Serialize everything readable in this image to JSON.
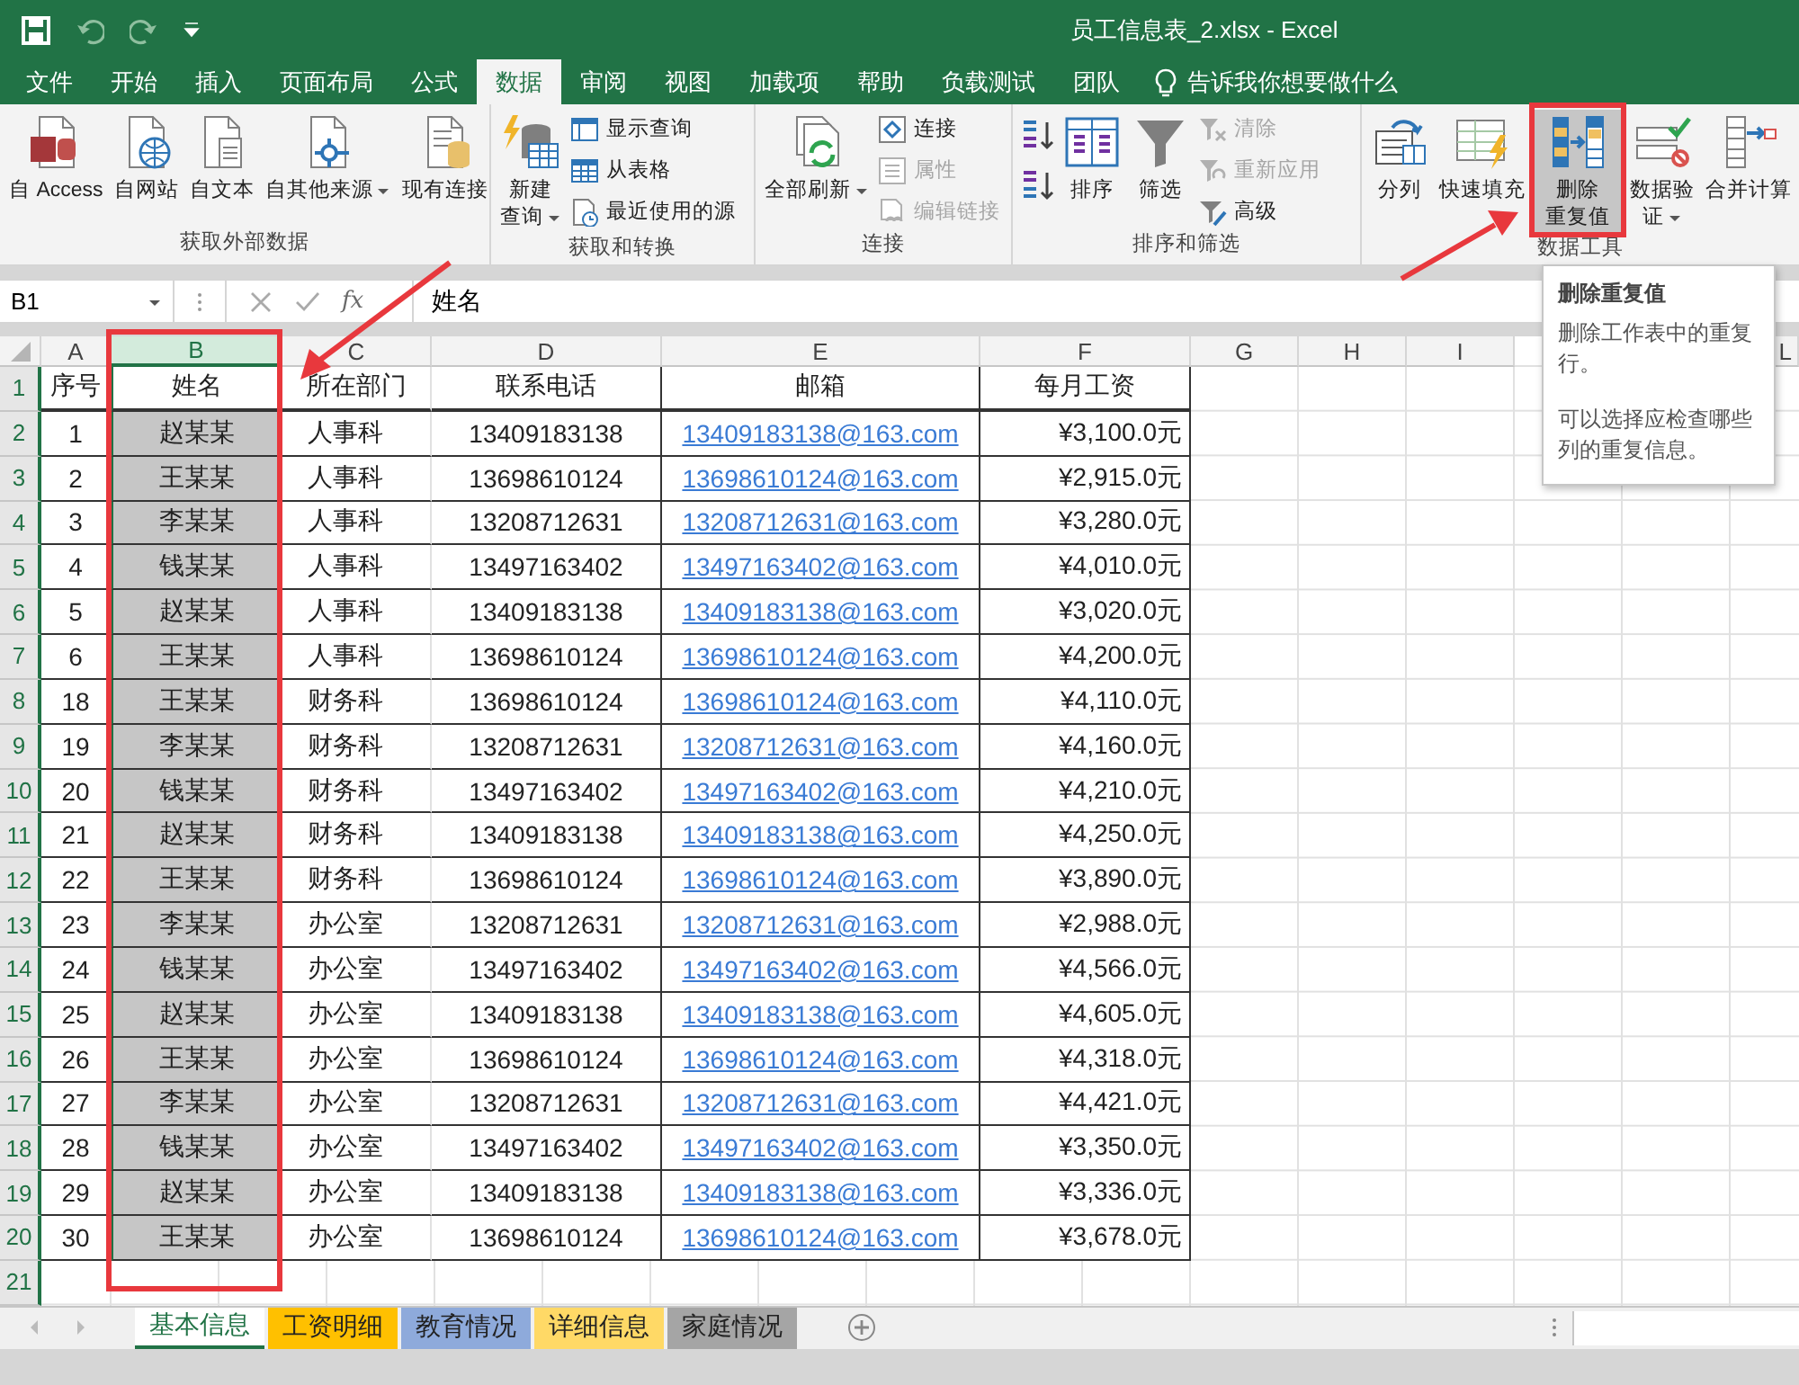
{
  "window": {
    "title": "员工信息表_2.xlsx  -  Excel"
  },
  "ribbon_tabs": [
    {
      "label": "文件",
      "selected": false
    },
    {
      "label": "开始",
      "selected": false
    },
    {
      "label": "插入",
      "selected": false
    },
    {
      "label": "页面布局",
      "selected": false
    },
    {
      "label": "公式",
      "selected": false
    },
    {
      "label": "数据",
      "selected": true
    },
    {
      "label": "审阅",
      "selected": false
    },
    {
      "label": "视图",
      "selected": false
    },
    {
      "label": "加载项",
      "selected": false
    },
    {
      "label": "帮助",
      "selected": false
    },
    {
      "label": "负载测试",
      "selected": false
    },
    {
      "label": "团队",
      "selected": false
    }
  ],
  "tell_me": "告诉我你想要做什么",
  "ribbon_groups": [
    {
      "label": "获取外部数据",
      "items": [
        {
          "kind": "large",
          "label": "自 Access",
          "highlighted": false
        },
        {
          "kind": "large",
          "label": "自网站",
          "highlighted": false
        },
        {
          "kind": "large",
          "label": "自文本",
          "highlighted": false
        },
        {
          "kind": "large",
          "label": "自其他来源",
          "highlighted": false,
          "caret": true
        },
        {
          "kind": "large",
          "label": "现有连接",
          "highlighted": false
        }
      ]
    },
    {
      "label": "获取和转换",
      "items": [
        {
          "kind": "large",
          "lines": [
            "新建",
            "查询"
          ],
          "highlighted": false,
          "caret": true
        },
        {
          "kind": "small",
          "label": "显示查询",
          "disabled": false
        },
        {
          "kind": "small",
          "label": "从表格",
          "disabled": false
        },
        {
          "kind": "small",
          "label": "最近使用的源",
          "disabled": false
        }
      ]
    },
    {
      "label": "连接",
      "items": [
        {
          "kind": "large",
          "label": "全部刷新",
          "highlighted": false,
          "caret": true
        },
        {
          "kind": "small",
          "label": "连接",
          "disabled": false
        },
        {
          "kind": "small",
          "label": "属性",
          "disabled": true
        },
        {
          "kind": "small",
          "label": "编辑链接",
          "disabled": true
        }
      ]
    },
    {
      "label": "排序和筛选",
      "items": [
        {
          "kind": "icon"
        },
        {
          "kind": "icon"
        },
        {
          "kind": "large",
          "label": "排序",
          "highlighted": false
        },
        {
          "kind": "large",
          "label": "筛选",
          "highlighted": false
        },
        {
          "kind": "small",
          "label": "清除",
          "disabled": true
        },
        {
          "kind": "small",
          "label": "重新应用",
          "disabled": true
        },
        {
          "kind": "small",
          "label": "高级",
          "disabled": false
        }
      ]
    },
    {
      "label": "数据工具",
      "items": [
        {
          "kind": "large",
          "label": "分列",
          "highlighted": false
        },
        {
          "kind": "large",
          "label": "快速填充",
          "highlighted": false
        },
        {
          "kind": "large",
          "lines": [
            "删除",
            "重复值"
          ],
          "highlighted": true
        },
        {
          "kind": "large",
          "lines": [
            "数据验",
            "证"
          ],
          "highlighted": false,
          "caret": true
        },
        {
          "kind": "large",
          "label": "合并计算",
          "highlighted": false
        }
      ]
    }
  ],
  "tooltip": {
    "title": "删除重复值",
    "paragraphs": [
      "删除工作表中的重复行。",
      "可以选择应检查哪些列的重复信息。"
    ]
  },
  "formula_bar": {
    "name_box": "B1",
    "function_label": "fx",
    "formula": "姓名"
  },
  "columns": [
    {
      "label": "A",
      "selected": false
    },
    {
      "label": "B",
      "selected": true
    },
    {
      "label": "C",
      "selected": false
    },
    {
      "label": "D",
      "selected": false
    },
    {
      "label": "E",
      "selected": false
    },
    {
      "label": "F",
      "selected": false
    },
    {
      "label": "G",
      "selected": false
    },
    {
      "label": "H",
      "selected": false
    },
    {
      "label": "I",
      "selected": false
    },
    {
      "label": "L",
      "selected": false
    }
  ],
  "rows": [
    {
      "number": "1",
      "cells": [
        "序号",
        "姓名",
        "所在部门",
        "联系电话",
        "邮箱",
        "每月工资"
      ]
    },
    {
      "number": "2",
      "cells": [
        "1",
        "赵某某",
        "人事科",
        "13409183138",
        "13409183138@163.com",
        "¥3,100.0元"
      ]
    },
    {
      "number": "3",
      "cells": [
        "2",
        "王某某",
        "人事科",
        "13698610124",
        "13698610124@163.com",
        "¥2,915.0元"
      ]
    },
    {
      "number": "4",
      "cells": [
        "3",
        "李某某",
        "人事科",
        "13208712631",
        "13208712631@163.com",
        "¥3,280.0元"
      ]
    },
    {
      "number": "5",
      "cells": [
        "4",
        "钱某某",
        "人事科",
        "13497163402",
        "13497163402@163.com",
        "¥4,010.0元"
      ]
    },
    {
      "number": "6",
      "cells": [
        "5",
        "赵某某",
        "人事科",
        "13409183138",
        "13409183138@163.com",
        "¥3,020.0元"
      ]
    },
    {
      "number": "7",
      "cells": [
        "6",
        "王某某",
        "人事科",
        "13698610124",
        "13698610124@163.com",
        "¥4,200.0元"
      ]
    },
    {
      "number": "8",
      "cells": [
        "18",
        "王某某",
        "财务科",
        "13698610124",
        "13698610124@163.com",
        "¥4,110.0元"
      ]
    },
    {
      "number": "9",
      "cells": [
        "19",
        "李某某",
        "财务科",
        "13208712631",
        "13208712631@163.com",
        "¥4,160.0元"
      ]
    },
    {
      "number": "10",
      "cells": [
        "20",
        "钱某某",
        "财务科",
        "13497163402",
        "13497163402@163.com",
        "¥4,210.0元"
      ]
    },
    {
      "number": "11",
      "cells": [
        "21",
        "赵某某",
        "财务科",
        "13409183138",
        "13409183138@163.com",
        "¥4,250.0元"
      ]
    },
    {
      "number": "12",
      "cells": [
        "22",
        "王某某",
        "财务科",
        "13698610124",
        "13698610124@163.com",
        "¥3,890.0元"
      ]
    },
    {
      "number": "13",
      "cells": [
        "23",
        "李某某",
        "办公室",
        "13208712631",
        "13208712631@163.com",
        "¥2,988.0元"
      ]
    },
    {
      "number": "14",
      "cells": [
        "24",
        "钱某某",
        "办公室",
        "13497163402",
        "13497163402@163.com",
        "¥4,566.0元"
      ]
    },
    {
      "number": "15",
      "cells": [
        "25",
        "赵某某",
        "办公室",
        "13409183138",
        "13409183138@163.com",
        "¥4,605.0元"
      ]
    },
    {
      "number": "16",
      "cells": [
        "26",
        "王某某",
        "办公室",
        "13698610124",
        "13698610124@163.com",
        "¥4,318.0元"
      ]
    },
    {
      "number": "17",
      "cells": [
        "27",
        "李某某",
        "办公室",
        "13208712631",
        "13208712631@163.com",
        "¥4,421.0元"
      ]
    },
    {
      "number": "18",
      "cells": [
        "28",
        "钱某某",
        "办公室",
        "13497163402",
        "13497163402@163.com",
        "¥3,350.0元"
      ]
    },
    {
      "number": "19",
      "cells": [
        "29",
        "赵某某",
        "办公室",
        "13409183138",
        "13409183138@163.com",
        "¥3,336.0元"
      ]
    },
    {
      "number": "20",
      "cells": [
        "30",
        "王某某",
        "办公室",
        "13698610124",
        "13698610124@163.com",
        "¥3,678.0元"
      ]
    },
    {
      "number": "21"
    }
  ],
  "sheet_tabs": [
    {
      "label": "基本信息",
      "selected": true
    },
    {
      "label": "工资明细",
      "selected": false,
      "color": "#ffc000"
    },
    {
      "label": "教育情况",
      "selected": false,
      "color": "#8eaadb"
    },
    {
      "label": "详细信息",
      "selected": false,
      "color": "#ffd966"
    },
    {
      "label": "家庭情况",
      "selected": false,
      "color": "#a5a5a5"
    }
  ]
}
